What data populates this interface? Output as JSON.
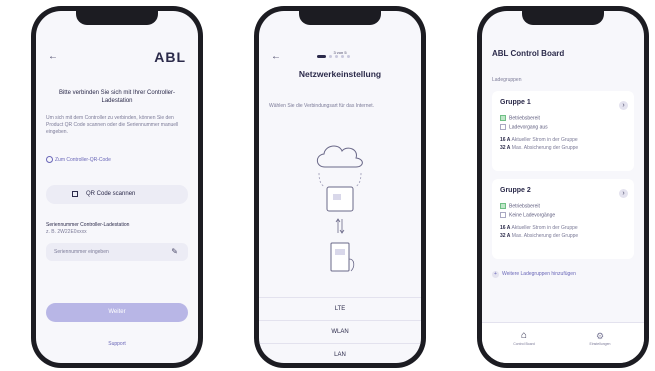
{
  "screen1": {
    "logo": "ABL",
    "title": "Bitte verbinden Sie sich mit Ihrer Controller-Ladestation",
    "body": "Um sich mit dem Controller zu verbinden, können Sie den Product QR Code scannen oder die Seriennummer manuell eingeben.",
    "hint": "Zum Controller-QR-Code",
    "qr_button": "QR Code scannen",
    "serial_label": "Seriennummer Controller-Ladestation",
    "serial_sub": "z. B. 2W22E0xxxx",
    "serial_placeholder": "Seriennummer eingeben",
    "primary_button": "Weiter",
    "support_link": "Support"
  },
  "screen2": {
    "step": "3 von 5",
    "title": "Netzwerkeinstellung",
    "description": "Wählen Sie die Verbindungsart für das Internet.",
    "options": [
      "LTE",
      "WLAN",
      "LAN"
    ]
  },
  "screen3": {
    "title": "ABL Control Board",
    "section": "Ladegruppen",
    "groups": [
      {
        "name": "Gruppe 1",
        "status_on": "Betriebsbereit",
        "status_off": "Ladevorgang aus",
        "v1": "16 A",
        "t1": "Aktueller Strom in der Gruppe",
        "v2": "32 A",
        "t2": "Max. Absicherung der Gruppe"
      },
      {
        "name": "Gruppe 2",
        "status_on": "Betriebsbereit",
        "status_off": "Keine Ladevorgänge",
        "v1": "16 A",
        "t1": "Aktueller Strom in der Gruppe",
        "v2": "32 A",
        "t2": "Max. Absicherung der Gruppe"
      }
    ],
    "add_link": "Weitere Ladegruppen hinzufügen",
    "nav": [
      "Control Board",
      "Einstellungen"
    ]
  }
}
